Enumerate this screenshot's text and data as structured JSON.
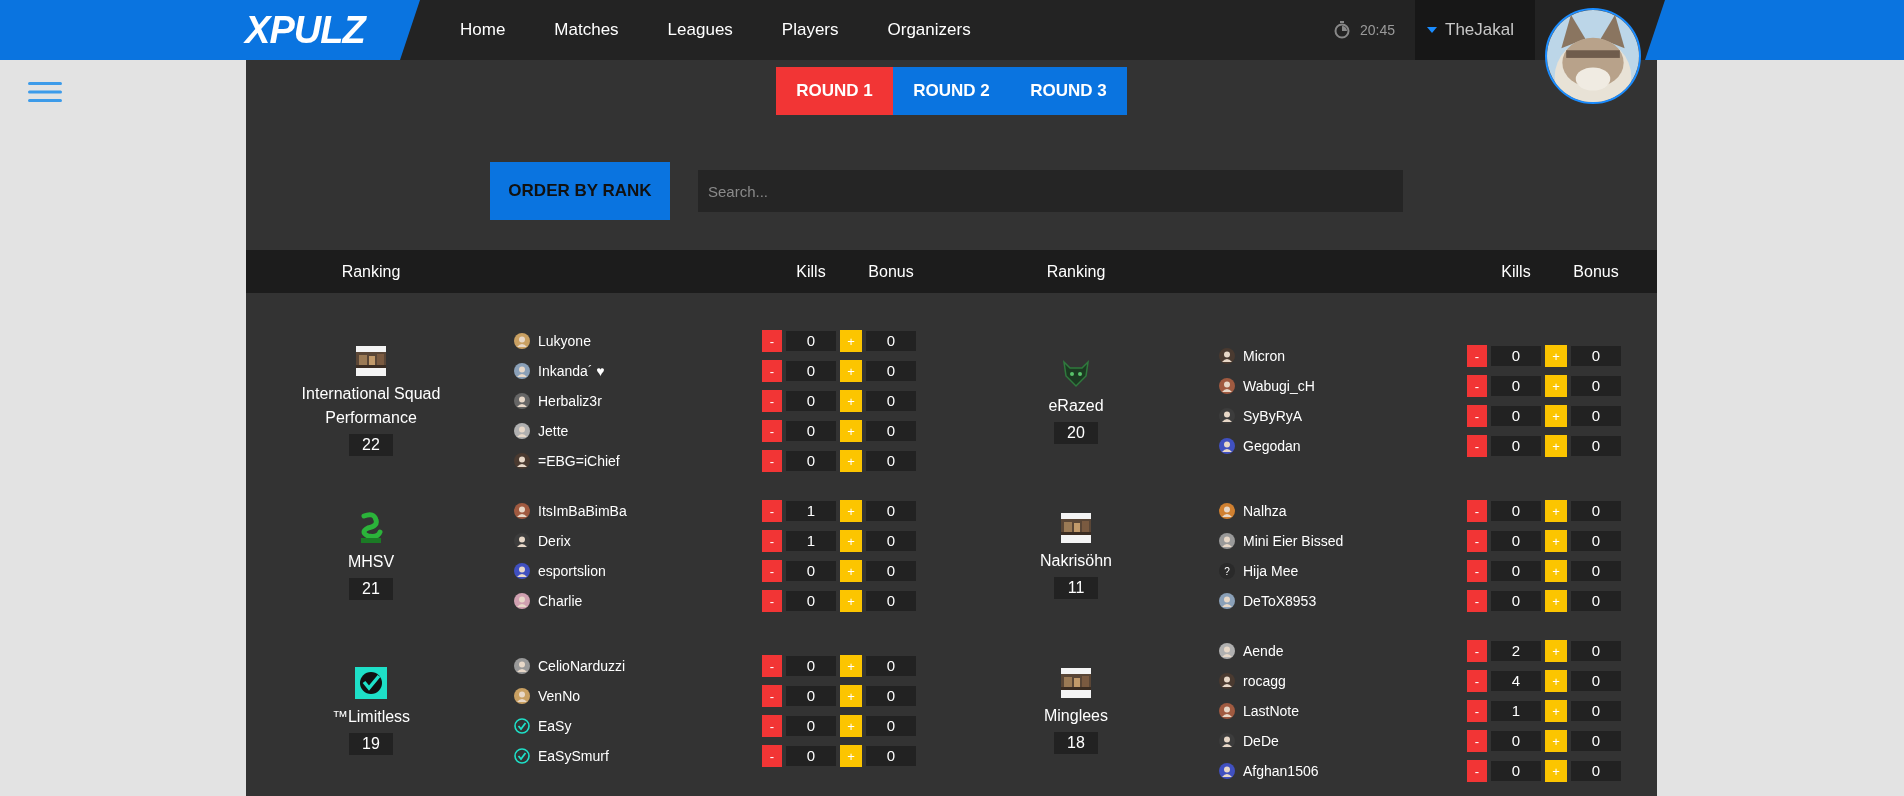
{
  "logo": "XPULZ",
  "nav": [
    {
      "label": "Home"
    },
    {
      "label": "Matches"
    },
    {
      "label": "Leagues"
    },
    {
      "label": "Players"
    },
    {
      "label": "Organizers"
    }
  ],
  "clock": "20:45",
  "user": {
    "name": "TheJakal"
  },
  "rounds": [
    {
      "label": "ROUND 1",
      "selected": true
    },
    {
      "label": "ROUND 2",
      "selected": false
    },
    {
      "label": "ROUND 3",
      "selected": false
    }
  ],
  "order_button": "ORDER BY RANK",
  "search": {
    "placeholder": "Search..."
  },
  "columns": [
    {
      "ranking": "Ranking",
      "kills": "Kills",
      "bonus": "Bonus"
    },
    {
      "ranking": "Ranking",
      "kills": "Kills",
      "bonus": "Bonus"
    }
  ],
  "left_column": [
    {
      "name": "International Squad Performance",
      "score": "22",
      "kind": "picture",
      "players": [
        {
          "name": "Lukyone",
          "kills": "0",
          "bonus": "0",
          "kind": "avatar"
        },
        {
          "name": "Inkanda´ ♥",
          "kills": "0",
          "bonus": "0",
          "kind": "avatar"
        },
        {
          "name": "Herbaliz3r",
          "kills": "0",
          "bonus": "0",
          "kind": "avatar"
        },
        {
          "name": "Jette",
          "kills": "0",
          "bonus": "0",
          "kind": "avatar"
        },
        {
          "name": "=EBG=iChief",
          "kills": "0",
          "bonus": "0",
          "kind": "avatar"
        }
      ]
    },
    {
      "name": "MHSV",
      "score": "21",
      "kind": "snake",
      "players": [
        {
          "name": "ItsImBaBimBa",
          "kills": "1",
          "bonus": "0",
          "kind": "avatar"
        },
        {
          "name": "Derix",
          "kills": "1",
          "bonus": "0",
          "kind": "avatar"
        },
        {
          "name": "esportslion",
          "kills": "0",
          "bonus": "0",
          "kind": "avatar"
        },
        {
          "name": "Charlie",
          "kills": "0",
          "bonus": "0",
          "kind": "avatar"
        }
      ]
    },
    {
      "name": "™Limitless",
      "score": "19",
      "kind": "check",
      "players": [
        {
          "name": "CelioNarduzzi",
          "kills": "0",
          "bonus": "0",
          "kind": "avatar"
        },
        {
          "name": "VenNo",
          "kills": "0",
          "bonus": "0",
          "kind": "avatar"
        },
        {
          "name": "EaSy",
          "kills": "0",
          "bonus": "0",
          "kind": "check"
        },
        {
          "name": "EaSySmurf",
          "kills": "0",
          "bonus": "0",
          "kind": "check"
        }
      ]
    }
  ],
  "right_column": [
    {
      "name": "eRazed",
      "score": "20",
      "kind": "emblem",
      "players": [
        {
          "name": "Micron",
          "kills": "0",
          "bonus": "0",
          "kind": "avatar"
        },
        {
          "name": "Wabugi_cH",
          "kills": "0",
          "bonus": "0",
          "kind": "avatar"
        },
        {
          "name": "SyByRyA",
          "kills": "0",
          "bonus": "0",
          "kind": "avatar"
        },
        {
          "name": "Gegodan",
          "kills": "0",
          "bonus": "0",
          "kind": "avatar"
        }
      ]
    },
    {
      "name": "Nakrisöhn",
      "score": "11",
      "kind": "picture",
      "players": [
        {
          "name": "Nalhza",
          "kills": "0",
          "bonus": "0",
          "kind": "avatar"
        },
        {
          "name": "Mini Eier Bissed",
          "kills": "0",
          "bonus": "0",
          "kind": "avatar"
        },
        {
          "name": "Hija Mee",
          "kills": "0",
          "bonus": "0",
          "kind": "unknown",
          "avatar_text": "?"
        },
        {
          "name": "DeToX8953",
          "kills": "0",
          "bonus": "0",
          "kind": "avatar"
        }
      ]
    },
    {
      "name": "Minglees",
      "score": "18",
      "kind": "picture",
      "players": [
        {
          "name": "Aende",
          "kills": "2",
          "bonus": "0",
          "kind": "avatar"
        },
        {
          "name": "rocagg",
          "kills": "4",
          "bonus": "0",
          "kind": "avatar"
        },
        {
          "name": "LastNote",
          "kills": "1",
          "bonus": "0",
          "kind": "avatar"
        },
        {
          "name": "DeDe",
          "kills": "0",
          "bonus": "0",
          "kind": "avatar"
        },
        {
          "name": "Afghan1506",
          "kills": "0",
          "bonus": "0",
          "kind": "avatar"
        }
      ]
    }
  ],
  "controls": {
    "minus": "-",
    "plus": "+"
  }
}
